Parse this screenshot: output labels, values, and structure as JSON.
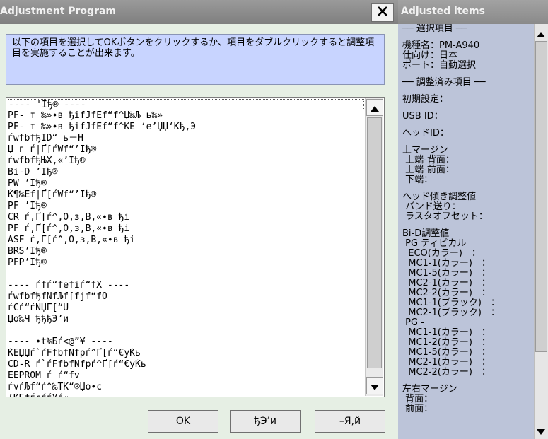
{
  "left_window": {
    "title": "Adjustment Program",
    "close_icon": "close-icon",
    "instructions": "以下の項目を選択してOKボタンをクリックするか、項目をダブルクリックすると調整項目を実施することが出来ます。",
    "items": [
      "---- 'Iђ® ----",
      "PF- т ‰»∙в ђіfЈfЕf“f^Џ‰Љ ь‰»",
      "PF- т ‰»∙в ђіfЈfЕf“f^ЌЕ ‘е’ЏЏ‘Ќђ,Э",
      "ѓwfbfђID“ ь－Н",
      "Џ г ѓ|Ґ[ѓWf“’Iђ®",
      "ѓwfbfђЊХ,«’Iђ®",
      "Bi-D ’Iђ®",
      "PW ’Iђ®",
      "Ќ¶‰Еf|Ґ[ѓWf“’Iђ®",
      "PF ’Iђ®",
      "CR ѓ,Ґ[ѓ^,O,з,В,«∙в ђі",
      "PF ѓ,Ґ[ѓ^,O,з,В,«∙в ђі",
      "ASF ѓ,Ґ[ѓ^,O,з,В,«∙в ђі",
      "BRS’Iђ®",
      "PFP’Iђ®",
      "",
      "---- ѓfѓ“fefіѓ“fX ----",
      "ѓwfbfђfNfЉf[fjf“fO",
      "ѓCѓ“ѓNЏЃ[“U",
      "Џо‰Ч ђђђЭ’и",
      "",
      "---- ∙t‰Бѓ<@”¥ ----",
      "ЌЕЏЏѓ`ѓFfbfNfpѓ^Ґ[ѓ“€уЌь",
      "CD-R ѓ`ѓFfbfNfpѓ^Ґ[ѓ“€уЌь",
      "EEPROM ѓ ѓ“fv",
      "ѓvѓЉf“ѓ^‰ТЌ“®Џо∙с",
      "’ЌБ‡ѓсѓѓ¥ѓ«"
    ],
    "buttons": {
      "ok": "OK",
      "back": "ђЭ’и",
      "exit": "–Я,й"
    },
    "scroll_up_icon": "scroll-up-icon",
    "scroll_down_icon": "scroll-down-icon"
  },
  "right_window": {
    "title": "Adjusted items",
    "lines": [
      "── 選択項目 ──",
      "",
      "機種名：PM-A940",
      "仕向け：日本",
      "ポート：自動選択",
      "",
      "── 調整済み項目 ──",
      "",
      "初期設定：",
      "",
      "USB ID：",
      "",
      "ヘッドID：",
      "",
      "上マージン",
      " 上端-背面：",
      " 上端-前面：",
      " 下端：",
      "",
      "ヘッド傾き調整値",
      " バンド送り：",
      " ラスタオフセット：",
      "",
      "Bi-D調整値",
      " PG ティピカル",
      "  ECO(カラー)　：",
      "  MC1-1(カラー)　：",
      "  MC1-5(カラー)　：",
      "  MC2-1(カラー)　：",
      "  MC2-2(カラー)　：",
      "  MC1-1(ブラック)　：",
      "  MC2-1(ブラック)　：",
      " PG -",
      "  MC1-1(カラー)　：",
      "  MC1-2(カラー)　：",
      "  MC1-5(カラー)　：",
      "  MC2-1(カラー)　：",
      "  MC2-2(カラー)　：",
      "",
      "左右マージン",
      " 背面：",
      " 前面："
    ]
  }
}
